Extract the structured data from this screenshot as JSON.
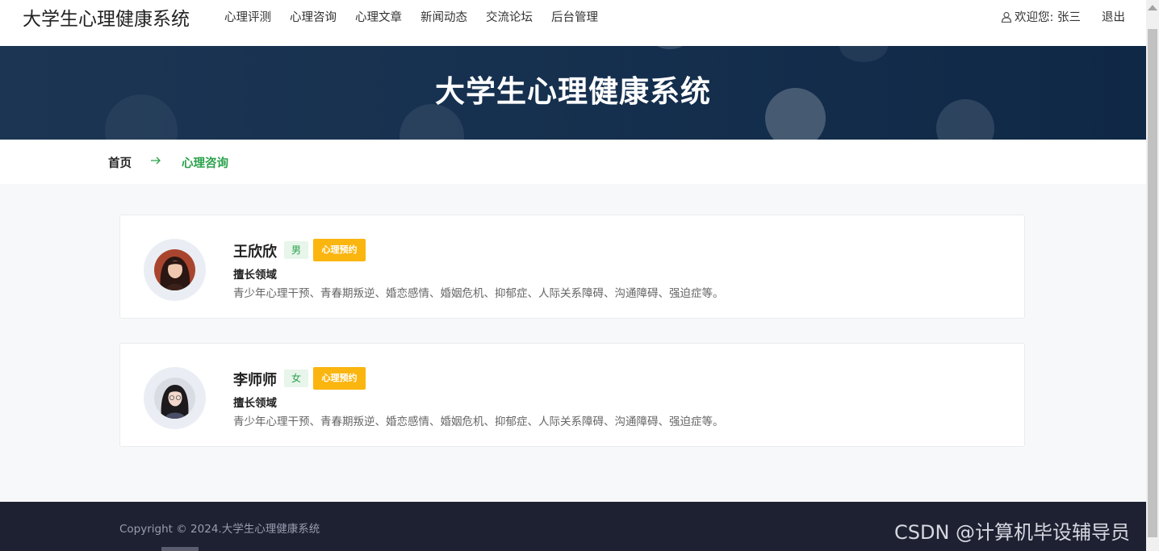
{
  "header": {
    "brand": "大学生心理健康系统",
    "nav": [
      "心理评测",
      "心理咨询",
      "心理文章",
      "新闻动态",
      "交流论坛",
      "后台管理"
    ],
    "welcome": "欢迎您: 张三",
    "logout": "退出"
  },
  "hero": {
    "title": "大学生心理健康系统"
  },
  "breadcrumb": {
    "home": "首页",
    "current": "心理咨询"
  },
  "counselors": [
    {
      "name": "王欣欣",
      "gender": "男",
      "appoint_label": "心理预约",
      "expertise_label": "擅长领域",
      "expertise": "青少年心理干预、青春期叛逆、婚恋感情、婚姻危机、抑郁症、人际关系障碍、沟通障碍、强迫症等。"
    },
    {
      "name": "李师师",
      "gender": "女",
      "appoint_label": "心理预约",
      "expertise_label": "擅长领域",
      "expertise": "青少年心理干预、青春期叛逆、婚恋感情、婚姻危机、抑郁症、人际关系障碍、沟通障碍、强迫症等。"
    }
  ],
  "footer": {
    "copyright": "Copyright © 2024.大学生心理健康系统"
  },
  "watermark": "CSDN @计算机毕设辅导员",
  "colors": {
    "accent_green": "#2aa14a",
    "appoint_yellow": "#fbb50f",
    "footer_bg": "#1e2132",
    "hero_bg": "#16304f"
  }
}
